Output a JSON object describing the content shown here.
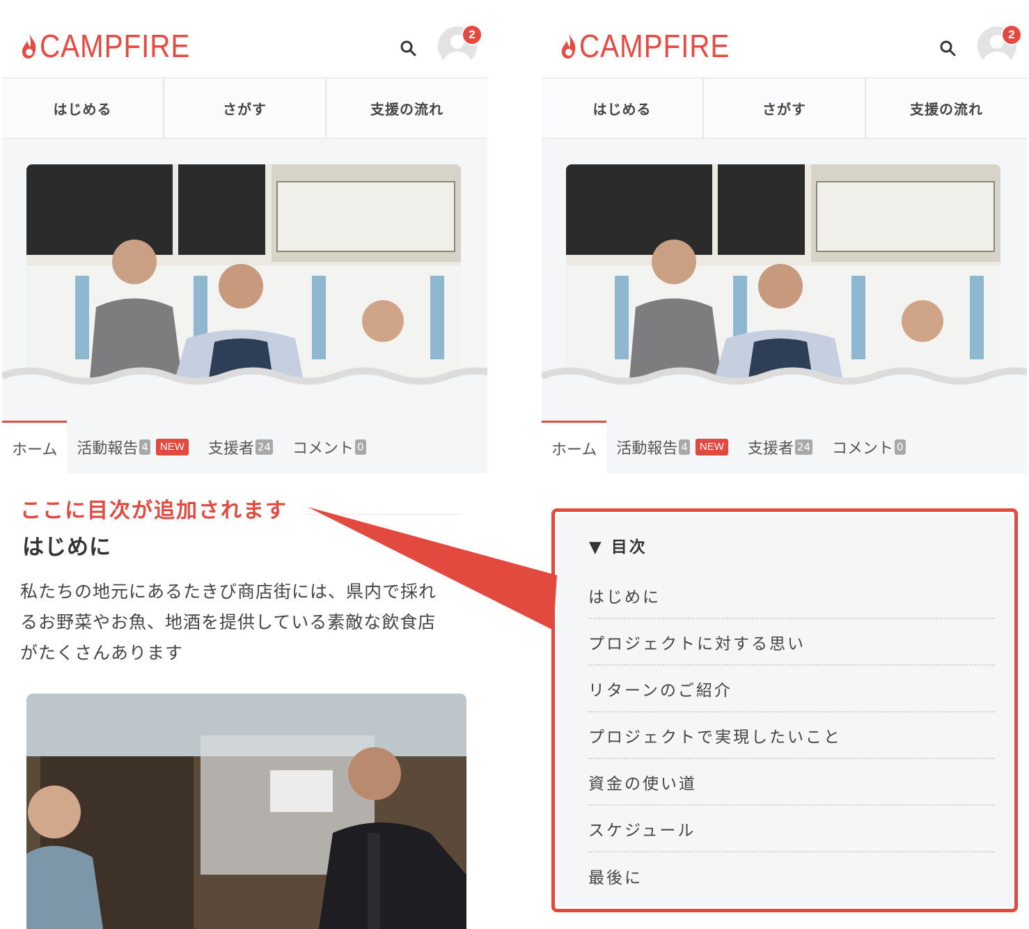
{
  "brand": {
    "name": "CAMPFIRE",
    "color": "#e34b43"
  },
  "header": {
    "notification_count": "2"
  },
  "nav": {
    "items": [
      "はじめる",
      "さがす",
      "支援の流れ"
    ]
  },
  "tabs": [
    {
      "label": "ホーム"
    },
    {
      "label": "活動報告",
      "count": "4",
      "badge": "NEW"
    },
    {
      "label": "支援者",
      "count": "24"
    },
    {
      "label": "コメント",
      "count": "0"
    }
  ],
  "left": {
    "annotation": "ここに目次が追加されます",
    "section_title": "はじめに",
    "body": "私たちの地元にあるたきび商店街には、県内で採れ\nるお野菜やお魚、地酒を提供している素敵な飲食店\nがたくさんあります"
  },
  "toc": {
    "title": "▼ 目次",
    "items": [
      "はじめに",
      "プロジェクトに対する思い",
      "リターンのご紹介",
      "プロジェクトで実現したいこと",
      "資金の使い道",
      "スケジュール",
      "最後に"
    ]
  },
  "colors": {
    "accent": "#e24a3f",
    "count_badge": "#a8a8a8",
    "panel_bg": "#f5f6f8"
  },
  "icons": {
    "search": "search-icon",
    "avatar": "user-avatar-icon",
    "flame": "flame-icon"
  }
}
